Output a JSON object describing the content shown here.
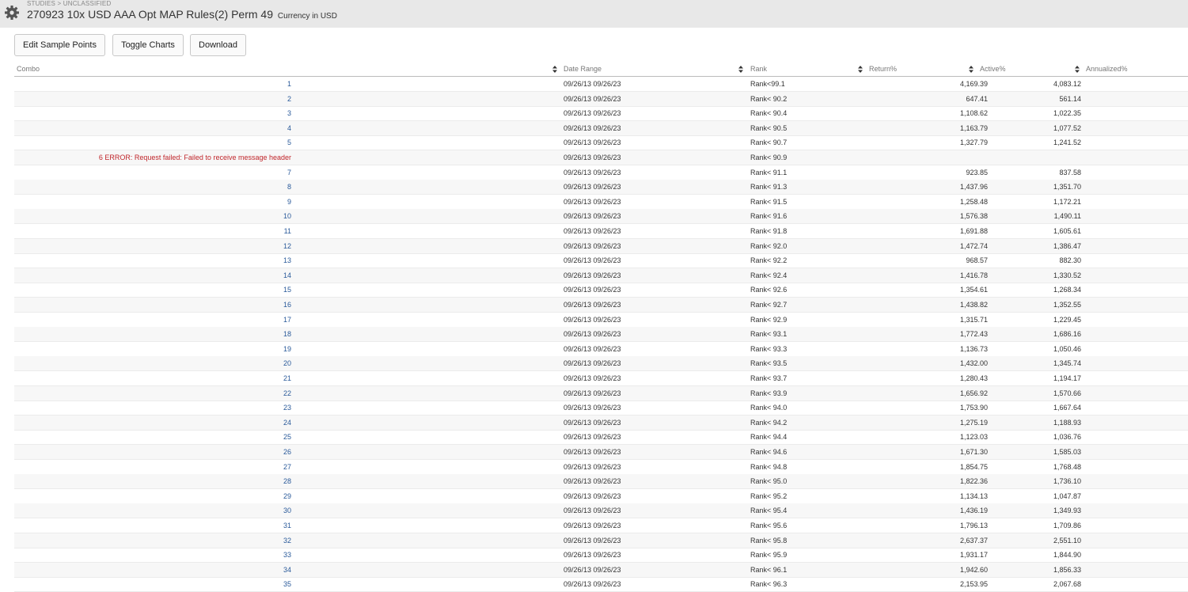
{
  "header": {
    "breadcrumb": "STUDIES > UNCLASSIFIED",
    "title": "270923 10x USD AAA Opt MAP Rules(2) Perm 49",
    "currency_note": "Currency in USD"
  },
  "toolbar": {
    "edit_label": "Edit Sample Points",
    "toggle_label": "Toggle Charts",
    "download_label": "Download"
  },
  "table": {
    "columns": [
      "Combo",
      "Date Range",
      "Rank",
      "Return%",
      "Active%",
      "Annualized%"
    ],
    "rows": [
      {
        "combo": "1",
        "date": "09/26/13 09/26/23",
        "rank": "Rank<99.1",
        "ret": "4,169.39",
        "act": "4,083.12"
      },
      {
        "combo": "2",
        "date": "09/26/13 09/26/23",
        "rank": "Rank< 90.2",
        "ret": "647.41",
        "act": "561.14"
      },
      {
        "combo": "3",
        "date": "09/26/13 09/26/23",
        "rank": "Rank< 90.4",
        "ret": "1,108.62",
        "act": "1,022.35"
      },
      {
        "combo": "4",
        "date": "09/26/13 09/26/23",
        "rank": "Rank< 90.5",
        "ret": "1,163.79",
        "act": "1,077.52"
      },
      {
        "combo": "5",
        "date": "09/26/13 09/26/23",
        "rank": "Rank< 90.7",
        "ret": "1,327.79",
        "act": "1,241.52"
      },
      {
        "combo": "6 ERROR: Request failed: Failed to receive message header",
        "date": "09/26/13 09/26/23",
        "rank": "Rank< 90.9",
        "ret": "",
        "act": "",
        "error": true
      },
      {
        "combo": "7",
        "date": "09/26/13 09/26/23",
        "rank": "Rank< 91.1",
        "ret": "923.85",
        "act": "837.58"
      },
      {
        "combo": "8",
        "date": "09/26/13 09/26/23",
        "rank": "Rank< 91.3",
        "ret": "1,437.96",
        "act": "1,351.70"
      },
      {
        "combo": "9",
        "date": "09/26/13 09/26/23",
        "rank": "Rank< 91.5",
        "ret": "1,258.48",
        "act": "1,172.21"
      },
      {
        "combo": "10",
        "date": "09/26/13 09/26/23",
        "rank": "Rank< 91.6",
        "ret": "1,576.38",
        "act": "1,490.11"
      },
      {
        "combo": "11",
        "date": "09/26/13 09/26/23",
        "rank": "Rank< 91.8",
        "ret": "1,691.88",
        "act": "1,605.61"
      },
      {
        "combo": "12",
        "date": "09/26/13 09/26/23",
        "rank": "Rank< 92.0",
        "ret": "1,472.74",
        "act": "1,386.47"
      },
      {
        "combo": "13",
        "date": "09/26/13 09/26/23",
        "rank": "Rank< 92.2",
        "ret": "968.57",
        "act": "882.30"
      },
      {
        "combo": "14",
        "date": "09/26/13 09/26/23",
        "rank": "Rank< 92.4",
        "ret": "1,416.78",
        "act": "1,330.52"
      },
      {
        "combo": "15",
        "date": "09/26/13 09/26/23",
        "rank": "Rank< 92.6",
        "ret": "1,354.61",
        "act": "1,268.34"
      },
      {
        "combo": "16",
        "date": "09/26/13 09/26/23",
        "rank": "Rank< 92.7",
        "ret": "1,438.82",
        "act": "1,352.55"
      },
      {
        "combo": "17",
        "date": "09/26/13 09/26/23",
        "rank": "Rank< 92.9",
        "ret": "1,315.71",
        "act": "1,229.45"
      },
      {
        "combo": "18",
        "date": "09/26/13 09/26/23",
        "rank": "Rank< 93.1",
        "ret": "1,772.43",
        "act": "1,686.16"
      },
      {
        "combo": "19",
        "date": "09/26/13 09/26/23",
        "rank": "Rank< 93.3",
        "ret": "1,136.73",
        "act": "1,050.46"
      },
      {
        "combo": "20",
        "date": "09/26/13 09/26/23",
        "rank": "Rank< 93.5",
        "ret": "1,432.00",
        "act": "1,345.74"
      },
      {
        "combo": "21",
        "date": "09/26/13 09/26/23",
        "rank": "Rank< 93.7",
        "ret": "1,280.43",
        "act": "1,194.17"
      },
      {
        "combo": "22",
        "date": "09/26/13 09/26/23",
        "rank": "Rank< 93.9",
        "ret": "1,656.92",
        "act": "1,570.66"
      },
      {
        "combo": "23",
        "date": "09/26/13 09/26/23",
        "rank": "Rank< 94.0",
        "ret": "1,753.90",
        "act": "1,667.64"
      },
      {
        "combo": "24",
        "date": "09/26/13 09/26/23",
        "rank": "Rank< 94.2",
        "ret": "1,275.19",
        "act": "1,188.93"
      },
      {
        "combo": "25",
        "date": "09/26/13 09/26/23",
        "rank": "Rank< 94.4",
        "ret": "1,123.03",
        "act": "1,036.76"
      },
      {
        "combo": "26",
        "date": "09/26/13 09/26/23",
        "rank": "Rank< 94.6",
        "ret": "1,671.30",
        "act": "1,585.03"
      },
      {
        "combo": "27",
        "date": "09/26/13 09/26/23",
        "rank": "Rank< 94.8",
        "ret": "1,854.75",
        "act": "1,768.48"
      },
      {
        "combo": "28",
        "date": "09/26/13 09/26/23",
        "rank": "Rank< 95.0",
        "ret": "1,822.36",
        "act": "1,736.10"
      },
      {
        "combo": "29",
        "date": "09/26/13 09/26/23",
        "rank": "Rank< 95.2",
        "ret": "1,134.13",
        "act": "1,047.87"
      },
      {
        "combo": "30",
        "date": "09/26/13 09/26/23",
        "rank": "Rank< 95.4",
        "ret": "1,436.19",
        "act": "1,349.93"
      },
      {
        "combo": "31",
        "date": "09/26/13 09/26/23",
        "rank": "Rank< 95.6",
        "ret": "1,796.13",
        "act": "1,709.86"
      },
      {
        "combo": "32",
        "date": "09/26/13 09/26/23",
        "rank": "Rank< 95.8",
        "ret": "2,637.37",
        "act": "2,551.10"
      },
      {
        "combo": "33",
        "date": "09/26/13 09/26/23",
        "rank": "Rank< 95.9",
        "ret": "1,931.17",
        "act": "1,844.90"
      },
      {
        "combo": "34",
        "date": "09/26/13 09/26/23",
        "rank": "Rank< 96.1",
        "ret": "1,942.60",
        "act": "1,856.33"
      },
      {
        "combo": "35",
        "date": "09/26/13 09/26/23",
        "rank": "Rank< 96.3",
        "ret": "2,153.95",
        "act": "2,067.68"
      }
    ]
  }
}
